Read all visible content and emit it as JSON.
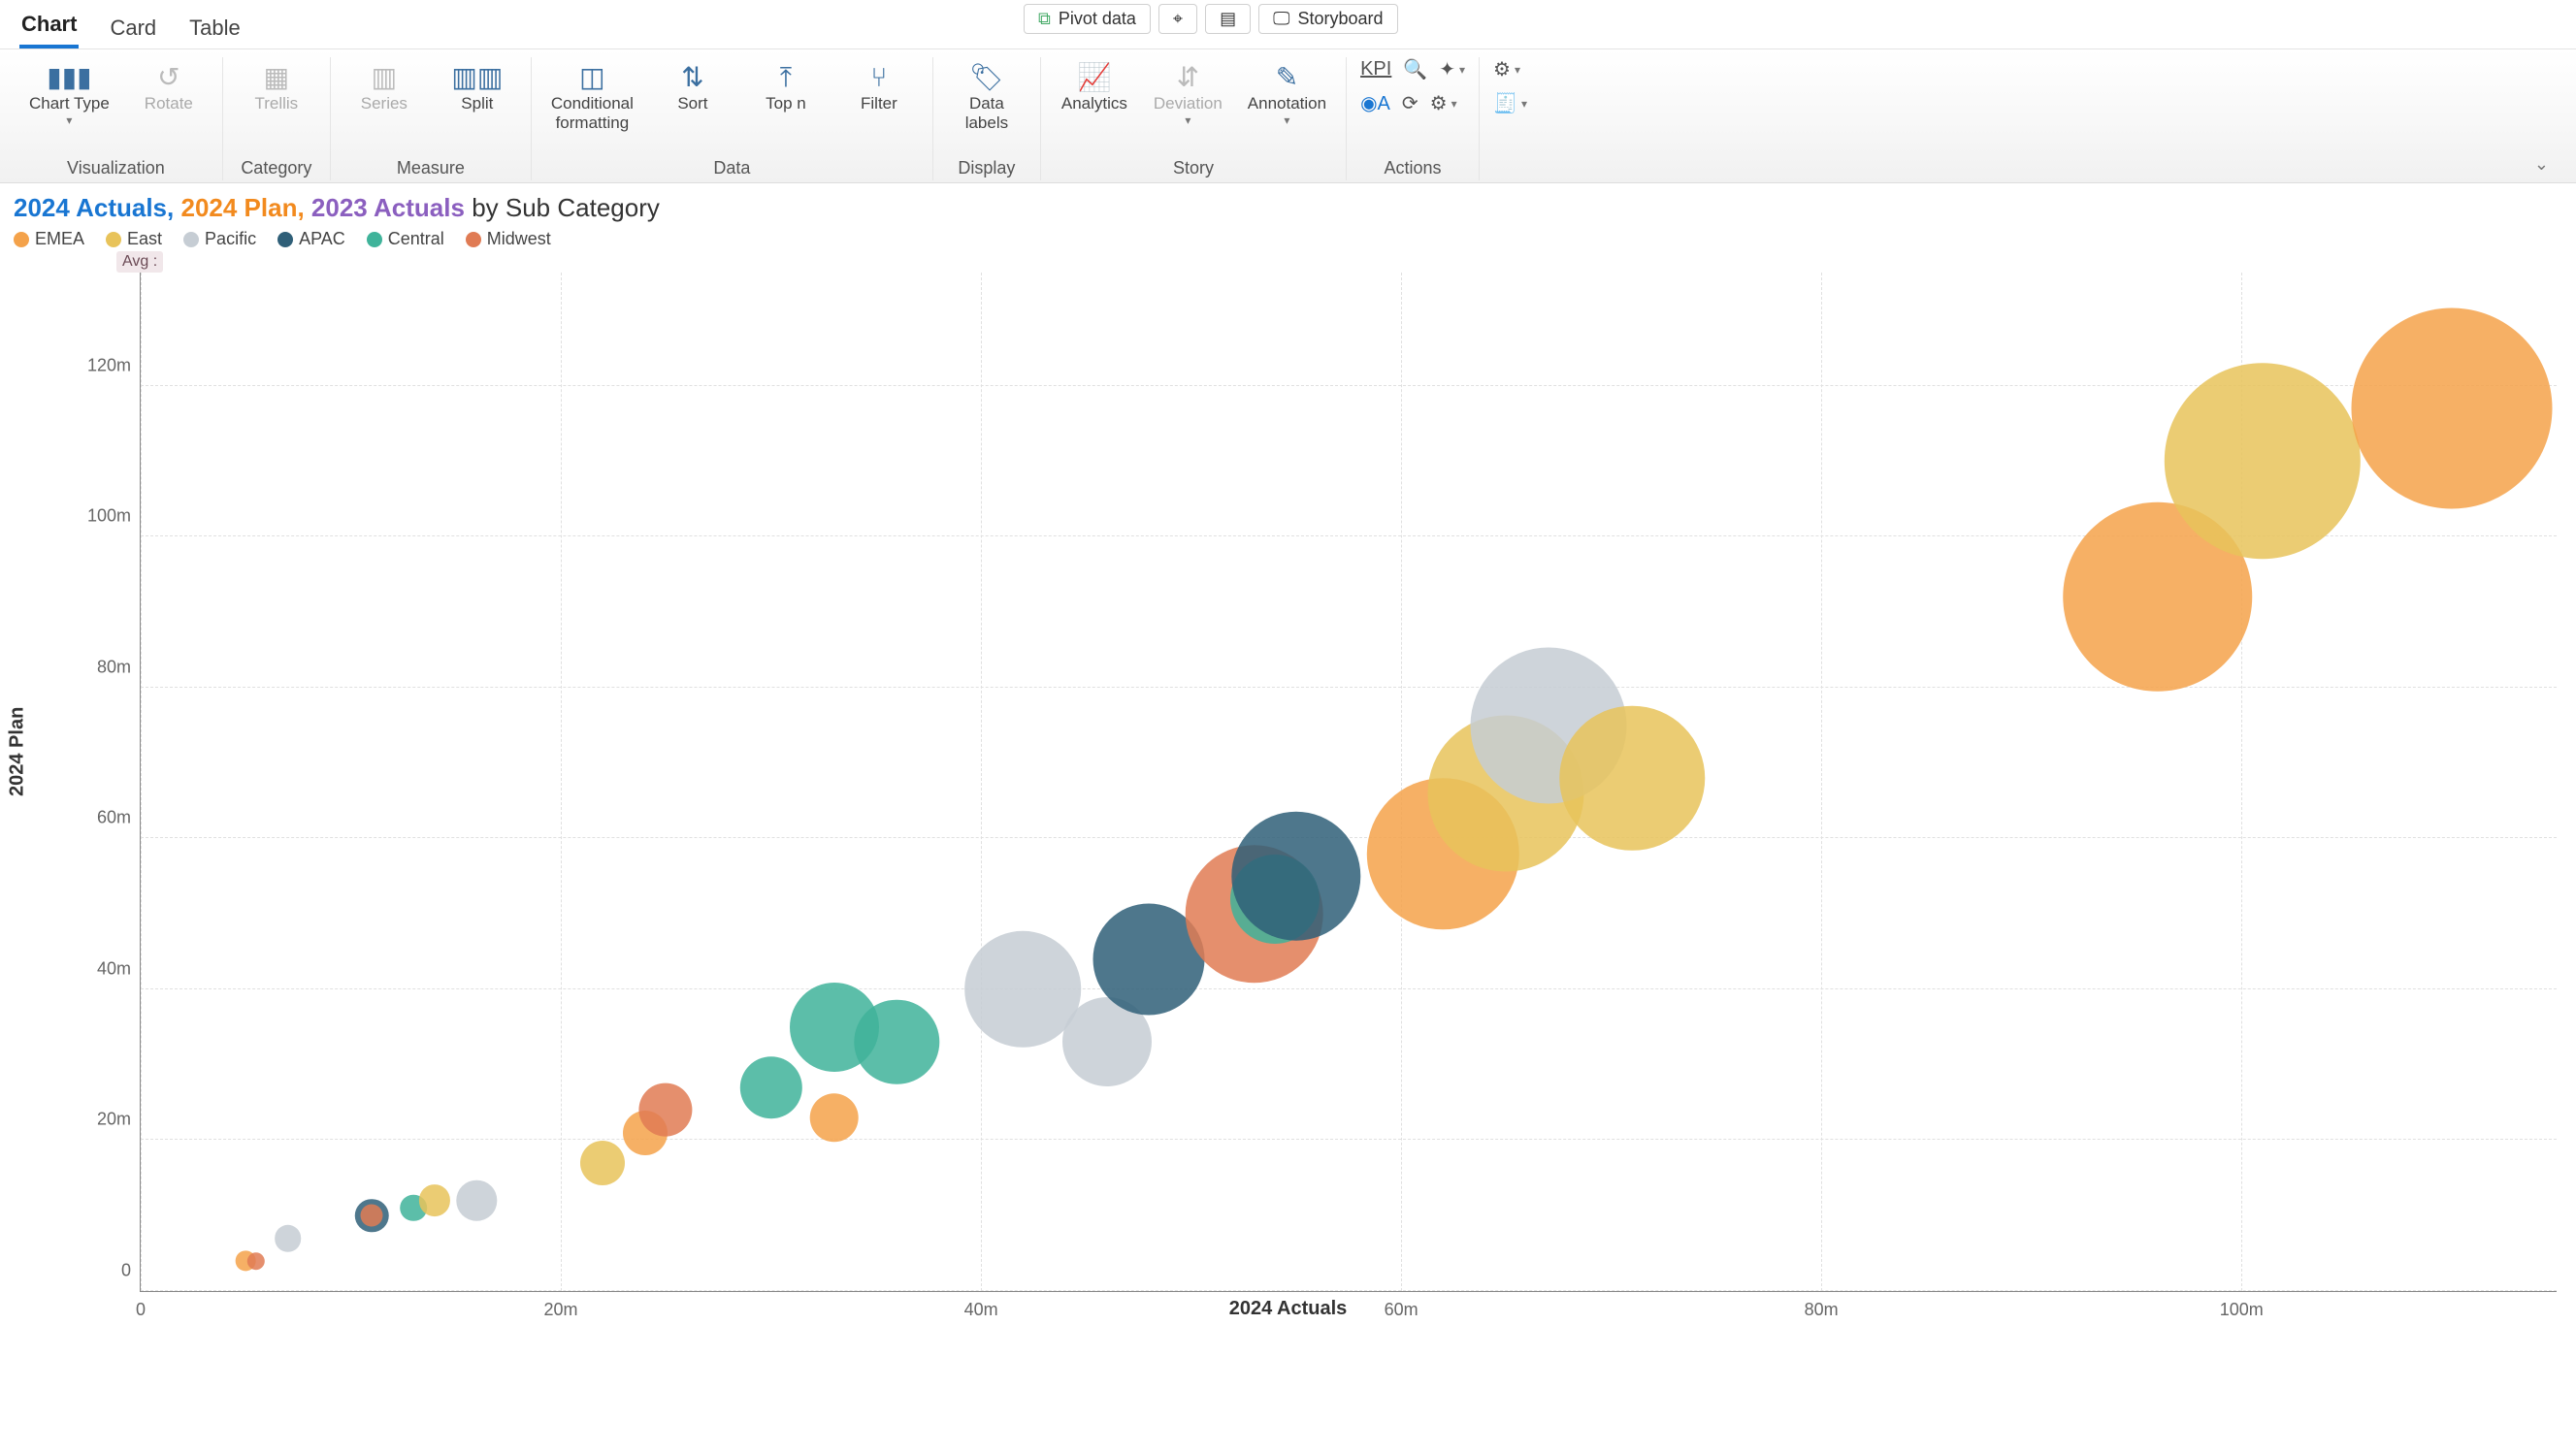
{
  "tabs": {
    "chart": "Chart",
    "card": "Card",
    "table": "Table",
    "active": "chart"
  },
  "top_actions": {
    "pivot": "Pivot  data",
    "storyboard": "Storyboard"
  },
  "ribbon": {
    "visualization": {
      "label": "Visualization",
      "chart_type": "Chart Type",
      "rotate": "Rotate"
    },
    "category": {
      "label": "Category",
      "trellis": "Trellis"
    },
    "measure": {
      "label": "Measure",
      "series": "Series",
      "split": "Split"
    },
    "data": {
      "label": "Data",
      "conditional": "Conditional\nformatting",
      "sort": "Sort",
      "topn": "Top n",
      "filter": "Filter"
    },
    "display": {
      "label": "Display",
      "data_labels": "Data\nlabels"
    },
    "story": {
      "label": "Story",
      "analytics": "Analytics",
      "deviation": "Deviation",
      "annotation": "Annotation"
    },
    "actions": {
      "label": "Actions",
      "kpi": "KPI"
    }
  },
  "title": {
    "a": "2024 Actuals,",
    "b": "2024 Plan,",
    "c": "2023 Actuals",
    "rest": " by Sub Category"
  },
  "legend_items": [
    {
      "name": "EMEA",
      "color": "#f4a24a"
    },
    {
      "name": "East",
      "color": "#e8c35a"
    },
    {
      "name": "Pacific",
      "color": "#c6cdd4"
    },
    {
      "name": "APAC",
      "color": "#2f5f78"
    },
    {
      "name": "Central",
      "color": "#3fb39a"
    },
    {
      "name": "Midwest",
      "color": "#e07b54"
    }
  ],
  "avg_label": "Avg :",
  "chart_data": {
    "type": "scatter",
    "title": "2024 Actuals, 2024 Plan, 2023 Actuals by Sub Category",
    "xlabel": "2024 Actuals",
    "ylabel": "2024 Plan",
    "size_encodes": "2023 Actuals",
    "color_encodes": "Region",
    "xlim": [
      0,
      115
    ],
    "ylim": [
      0,
      135
    ],
    "x_ticks": [
      0,
      20,
      40,
      60,
      80,
      100
    ],
    "y_ticks": [
      0,
      20,
      40,
      60,
      80,
      100,
      120
    ],
    "tick_suffix": "m",
    "series": [
      {
        "name": "EMEA",
        "color": "#f4a24a"
      },
      {
        "name": "East",
        "color": "#e8c35a"
      },
      {
        "name": "Pacific",
        "color": "#c6cdd4"
      },
      {
        "name": "APAC",
        "color": "#2f5f78"
      },
      {
        "name": "Central",
        "color": "#3fb39a"
      },
      {
        "name": "Midwest",
        "color": "#e07b54"
      }
    ],
    "points": [
      {
        "region": "EMEA",
        "x": 5,
        "y": 4,
        "r": 9
      },
      {
        "region": "Midwest",
        "x": 5.5,
        "y": 4,
        "r": 8
      },
      {
        "region": "Pacific",
        "x": 7,
        "y": 7,
        "r": 12
      },
      {
        "region": "APAC",
        "x": 11,
        "y": 10,
        "r": 15
      },
      {
        "region": "Midwest",
        "x": 11,
        "y": 10,
        "r": 10
      },
      {
        "region": "Central",
        "x": 13,
        "y": 11,
        "r": 12
      },
      {
        "region": "East",
        "x": 14,
        "y": 12,
        "r": 14
      },
      {
        "region": "Pacific",
        "x": 16,
        "y": 12,
        "r": 18
      },
      {
        "region": "East",
        "x": 22,
        "y": 17,
        "r": 20
      },
      {
        "region": "EMEA",
        "x": 24,
        "y": 21,
        "r": 20
      },
      {
        "region": "Midwest",
        "x": 25,
        "y": 24,
        "r": 24
      },
      {
        "region": "Central",
        "x": 30,
        "y": 27,
        "r": 28
      },
      {
        "region": "EMEA",
        "x": 33,
        "y": 23,
        "r": 22
      },
      {
        "region": "Central",
        "x": 33,
        "y": 35,
        "r": 40
      },
      {
        "region": "Central",
        "x": 36,
        "y": 33,
        "r": 38
      },
      {
        "region": "Pacific",
        "x": 42,
        "y": 40,
        "r": 52
      },
      {
        "region": "Pacific",
        "x": 46,
        "y": 33,
        "r": 40
      },
      {
        "region": "APAC",
        "x": 48,
        "y": 44,
        "r": 50
      },
      {
        "region": "Midwest",
        "x": 53,
        "y": 50,
        "r": 62
      },
      {
        "region": "Central",
        "x": 54,
        "y": 52,
        "r": 40
      },
      {
        "region": "APAC",
        "x": 55,
        "y": 55,
        "r": 58
      },
      {
        "region": "EMEA",
        "x": 62,
        "y": 58,
        "r": 68
      },
      {
        "region": "East",
        "x": 65,
        "y": 66,
        "r": 70
      },
      {
        "region": "Pacific",
        "x": 67,
        "y": 75,
        "r": 70
      },
      {
        "region": "East",
        "x": 71,
        "y": 68,
        "r": 65
      },
      {
        "region": "EMEA",
        "x": 96,
        "y": 92,
        "r": 85
      },
      {
        "region": "East",
        "x": 101,
        "y": 110,
        "r": 88
      },
      {
        "region": "EMEA",
        "x": 110,
        "y": 117,
        "r": 90
      }
    ]
  }
}
